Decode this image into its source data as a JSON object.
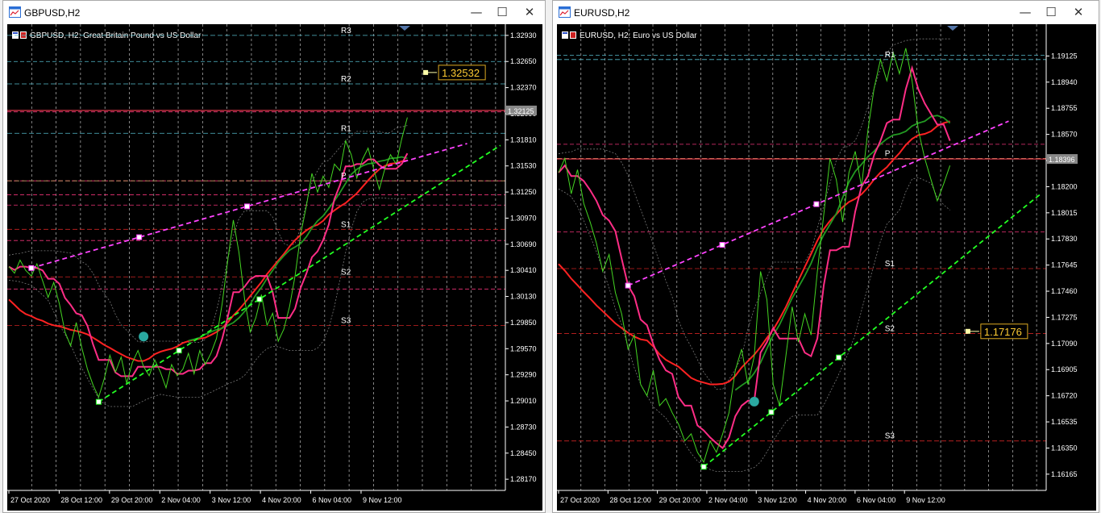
{
  "windows": [
    {
      "title": "GBPUSD,H2",
      "controls": {
        "minimize": "—",
        "maximize": "☐",
        "close": "✕"
      },
      "chart_header": "GBPUSD, H2:  Great Britain Pound vs US Dollar",
      "price_axis": [
        "1.32930",
        "1.32650",
        "1.32370",
        "1.32090",
        "1.31810",
        "1.31530",
        "1.31250",
        "1.30970",
        "1.30690",
        "1.30410",
        "1.30130",
        "1.29850",
        "1.29570",
        "1.29290",
        "1.29010",
        "1.28730",
        "1.28450",
        "1.28170"
      ],
      "time_axis": [
        "27 Oct 2020",
        "28 Oct 12:00",
        "29 Oct 20:00",
        "2 Nov 04:00",
        "3 Nov 12:00",
        "4 Nov 20:00",
        "6 Nov 04:00",
        "9 Nov 12:00"
      ],
      "pivot_labels": [
        "R3",
        "R2",
        "R1",
        "P",
        "S1",
        "S2",
        "S3"
      ],
      "current_price": "1.32125",
      "price_tag": "1.32532",
      "colors": {
        "background": "#000000",
        "price_line": "#44d522",
        "bb": "#777777",
        "pink": "#ff2d86",
        "red": "#ff2222",
        "green_ma": "#229922",
        "magenta_trend": "#ff44ff",
        "green_trend": "#22ff22",
        "pivot_cyan": "#55bbcc",
        "pivot_red": "#cc2222",
        "pivot_pink": "#ee3377",
        "grid": "#bbbbbb",
        "text": "#ffffff",
        "teal_dot": "#2aa8a0",
        "tag_border": "#ddaa22"
      }
    },
    {
      "title": "EURUSD,H2",
      "controls": {
        "minimize": "—",
        "maximize": "☐",
        "close": "✕"
      },
      "chart_header": "EURUSD, H2:  Euro vs US Dollar",
      "price_axis": [
        "1.19125",
        "1.18940",
        "1.18755",
        "1.18570",
        "1.18385",
        "1.18200",
        "1.18015",
        "1.17830",
        "1.17645",
        "1.17460",
        "1.17275",
        "1.17090",
        "1.16905",
        "1.16720",
        "1.16535",
        "1.16350",
        "1.16165"
      ],
      "time_axis": [
        "27 Oct 2020",
        "28 Oct 12:00",
        "29 Oct 20:00",
        "2 Nov 04:00",
        "3 Nov 12:00",
        "4 Nov 20:00",
        "6 Nov 04:00",
        "9 Nov 12:00"
      ],
      "pivot_labels": [
        "R1",
        "P",
        "S1",
        "S2",
        "S3"
      ],
      "current_price": "1.18396",
      "price_tag": "1.17176",
      "colors": {
        "background": "#000000",
        "price_line": "#44d522",
        "bb": "#777777",
        "pink": "#ff2d86",
        "red": "#ff2222",
        "green_ma": "#229922",
        "magenta_trend": "#ff44ff",
        "green_trend": "#22ff22",
        "pivot_cyan": "#55bbcc",
        "pivot_red": "#cc2222",
        "pivot_pink": "#ee3377",
        "grid": "#bbbbbb",
        "text": "#ffffff",
        "teal_dot": "#2aa8a0",
        "tag_border": "#ddaa22"
      }
    }
  ],
  "chart_data": [
    {
      "type": "line",
      "symbol": "GBPUSD",
      "timeframe": "H2",
      "title": "GBPUSD, H2:  Great Britain Pound vs US Dollar",
      "x_ticks": [
        "27 Oct 2020",
        "28 Oct 12:00",
        "29 Oct 20:00",
        "2 Nov 04:00",
        "3 Nov 12:00",
        "4 Nov 20:00",
        "6 Nov 04:00",
        "9 Nov 12:00"
      ],
      "ylim": [
        1.2805,
        1.3305
      ],
      "grid": true,
      "series": [
        {
          "values": [
            1.3045,
            1.3038,
            1.3052,
            1.3041,
            1.3035,
            1.3048,
            1.303,
            1.3012,
            1.3028,
            1.3005,
            1.2975,
            1.296,
            1.2985,
            1.2958,
            1.2935,
            1.2918,
            1.2905,
            1.2925,
            1.295,
            1.2932,
            1.2948,
            1.292,
            1.2942,
            1.2955,
            1.2938,
            1.2928,
            1.2945,
            1.2932,
            1.2915,
            1.294,
            1.2928,
            1.2935,
            1.2952,
            1.293,
            1.2955,
            1.294,
            1.2952,
            1.2968,
            1.3005,
            1.3052,
            1.3095,
            1.306,
            1.301,
            1.2975,
            1.299,
            1.3015,
            1.2982,
            1.2995,
            1.2965,
            1.2978,
            1.3002,
            1.3035,
            1.308,
            1.311,
            1.3145,
            1.3125,
            1.3142,
            1.313,
            1.3155,
            1.3148,
            1.318,
            1.3165,
            1.314,
            1.316,
            1.3172,
            1.315,
            1.3128,
            1.315,
            1.3165,
            1.3155,
            1.3182,
            1.3205
          ]
        }
      ],
      "pivots": {
        "R3": 1.3293,
        "R2": 1.3241,
        "R1": 1.3188,
        "P": 1.3137,
        "S1": 1.3085,
        "S2": 1.3034,
        "S3": 1.2982
      },
      "horizontal_levels": [
        1.3265,
        1.3211,
        1.3137,
        1.3122,
        1.3111,
        1.3073,
        1.3021
      ],
      "current_price": 1.32125,
      "alert_price": 1.32532
    },
    {
      "type": "line",
      "symbol": "EURUSD",
      "timeframe": "H2",
      "title": "EURUSD, H2:  Euro vs US Dollar",
      "x_ticks": [
        "27 Oct 2020",
        "28 Oct 12:00",
        "29 Oct 20:00",
        "2 Nov 04:00",
        "3 Nov 12:00",
        "4 Nov 20:00",
        "6 Nov 04:00",
        "9 Nov 12:00"
      ],
      "ylim": [
        1.1605,
        1.1935
      ],
      "grid": true,
      "series": [
        {
          "values": [
            1.183,
            1.184,
            1.1815,
            1.1832,
            1.1808,
            1.1795,
            1.178,
            1.176,
            1.1772,
            1.1745,
            1.173,
            1.1705,
            1.1715,
            1.168,
            1.1672,
            1.169,
            1.1665,
            1.167,
            1.166,
            1.1652,
            1.164,
            1.1645,
            1.1632,
            1.1625,
            1.164,
            1.1632,
            1.1645,
            1.166,
            1.169,
            1.1705,
            1.168,
            1.17,
            1.176,
            1.174,
            1.168,
            1.1665,
            1.17,
            1.1735,
            1.171,
            1.173,
            1.1715,
            1.176,
            1.18,
            1.184,
            1.1825,
            1.1795,
            1.183,
            1.1845,
            1.182,
            1.186,
            1.189,
            1.191,
            1.1895,
            1.1915,
            1.19,
            1.1918,
            1.1895,
            1.186,
            1.184,
            1.1825,
            1.181,
            1.1822,
            1.1835
          ]
        }
      ],
      "pivots": {
        "R1": 1.191,
        "P": 1.184,
        "S1": 1.1762,
        "S2": 1.1716,
        "S3": 1.164
      },
      "horizontal_levels": [
        1.1913,
        1.185,
        1.1788
      ],
      "current_price": 1.18396,
      "alert_price": 1.17176
    }
  ]
}
